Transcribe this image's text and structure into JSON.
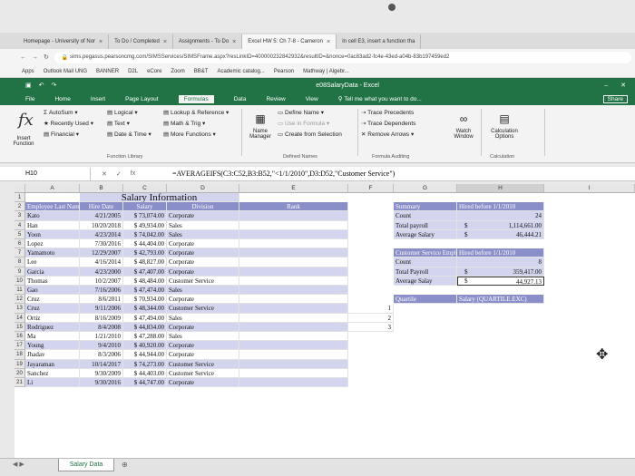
{
  "browser": {
    "tabs": [
      "Homepage - University of Nor",
      "To Do / Completed",
      "Assignments - To Do",
      "Excel HW 5: Ch 7-8 - Cameron",
      "In cell E3, insert a function tha"
    ],
    "url": "sims.pegasus.pearsoncmg.com/SIMSServices/SIMSFrame.aspx?resLinkID=400000232842932&resultID=&nonce=0ac83ad2-fc4e-43ed-a04b-83b197459ed2",
    "bookmarks": [
      "Apps",
      "Outlook Mail UNG",
      "BANNER",
      "D2L",
      "eCore",
      "Zoom",
      "BB&T",
      "Academic catalog...",
      "Pearson",
      "Mathway | Algebr..."
    ]
  },
  "excel": {
    "title": "e08SalaryData - Excel",
    "menu": [
      "File",
      "Home",
      "Insert",
      "Page Layout",
      "Formulas",
      "Data",
      "Review",
      "View"
    ],
    "tell_me": "Tell me what you want to do...",
    "user": "SIMS",
    "share": "Share",
    "ribbon": {
      "insert_function": "Insert Function",
      "autosum": "AutoSum",
      "recently_used": "Recently Used",
      "financial": "Financial",
      "logical": "Logical",
      "text": "Text",
      "date_time": "Date & Time",
      "lookup": "Lookup & Reference",
      "math_trig": "Math & Trig",
      "more_functions": "More Functions",
      "function_library": "Function Library",
      "name_manager": "Name Manager",
      "define_name": "Define Name",
      "use_in_formula": "Use in Formula",
      "create_from_selection": "Create from Selection",
      "defined_names": "Defined Names",
      "trace_precedents": "Trace Precedents",
      "trace_dependents": "Trace Dependents",
      "remove_arrows": "Remove Arrows",
      "formula_auditing": "Formula Auditing",
      "watch_window": "Watch Window",
      "calc_options": "Calculation Options",
      "calculation": "Calculation"
    },
    "name_box": "H10",
    "formula": "=AVERAGEIFS(C3:C52,B3:B52,\"<1/1/2010\",D3:D52,\"Customer Service\")",
    "sheet_tab": "Salary Data",
    "columns": [
      "A",
      "B",
      "C",
      "D",
      "E",
      "F",
      "G",
      "H",
      "I"
    ],
    "row_numbers": [
      "1",
      "2",
      "3",
      "4",
      "5",
      "6",
      "7",
      "8",
      "9",
      "10",
      "11",
      "12",
      "13",
      "14",
      "15",
      "16",
      "17",
      "18",
      "19",
      "20",
      "21"
    ]
  },
  "sheet": {
    "title": "Salary Information",
    "headers": [
      "Employee Last Name",
      "Hire Date",
      "Salary",
      "Division",
      "Rank"
    ],
    "rows": [
      [
        "Kato",
        "4/21/2005",
        "$ 73,074.00",
        "Corporate"
      ],
      [
        "Han",
        "10/20/2018",
        "$ 49,934.00",
        "Sales"
      ],
      [
        "Yoon",
        "4/23/2014",
        "$ 74,042.00",
        "Sales"
      ],
      [
        "Lopez",
        "7/30/2016",
        "$ 44,404.00",
        "Corporate"
      ],
      [
        "Yamamoto",
        "12/29/2007",
        "$ 42,793.00",
        "Corporate"
      ],
      [
        "Lee",
        "4/16/2014",
        "$ 48,827.00",
        "Corporate"
      ],
      [
        "Garcia",
        "4/23/2000",
        "$ 47,407.00",
        "Corporate"
      ],
      [
        "Thomas",
        "10/2/2007",
        "$ 48,484.00",
        "Customer Service"
      ],
      [
        "Gao",
        "7/16/2006",
        "$ 47,474.00",
        "Sales"
      ],
      [
        "Cruz",
        "8/6/2011",
        "$ 70,934.00",
        "Corporate"
      ],
      [
        "Cruz",
        "9/11/2006",
        "$ 48,344.00",
        "Customer Service"
      ],
      [
        "Ortiz",
        "8/16/2009",
        "$ 47,494.00",
        "Sales"
      ],
      [
        "Rodriguez",
        "8/4/2008",
        "$ 44,834.00",
        "Corporate"
      ],
      [
        "Ma",
        "1/21/2010",
        "$ 47,288.00",
        "Sales"
      ],
      [
        "Young",
        "9/4/2010",
        "$ 40,920.00",
        "Corporate"
      ],
      [
        "Jhadav",
        "8/3/2006",
        "$ 44,944.00",
        "Corporate"
      ],
      [
        "Jayaraman",
        "10/14/2017",
        "$ 74,273.00",
        "Customer Service"
      ],
      [
        "Sanchez",
        "9/30/2009",
        "$ 44,403.00",
        "Customer Service"
      ],
      [
        "Li",
        "9/30/2016",
        "$ 44,747.00",
        "Corporate"
      ]
    ],
    "summary": {
      "h1": "Summary",
      "h2": "Hired before 1/1/2010",
      "rows": [
        [
          "Count",
          "",
          "24"
        ],
        [
          "Total payroll",
          "$",
          "1,114,661.00"
        ],
        [
          "Average Salary",
          "$",
          "46,444.21"
        ]
      ]
    },
    "cs": {
      "h1": "Customer Service Employees",
      "h2": "Hired before 1/1/2010",
      "rows": [
        [
          "Count",
          "",
          "8"
        ],
        [
          "Total Payroll",
          "$",
          "359,417.00"
        ],
        [
          "Average Salay",
          "$",
          "44,927.13"
        ]
      ]
    },
    "quartile": {
      "h1": "Quartile",
      "h2": "Salary (QUARTILE.EXC)",
      "values": [
        "1",
        "2",
        "3"
      ]
    }
  }
}
